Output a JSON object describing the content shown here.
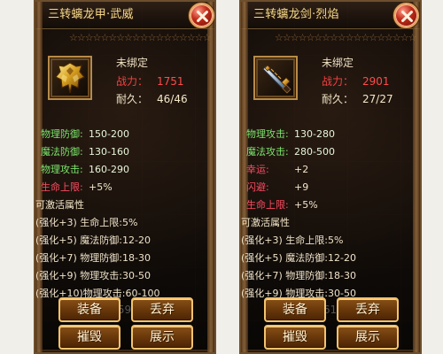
{
  "panels": [
    {
      "title": "三转螭龙甲·武威",
      "status": "未绑定",
      "power_label": "战力：",
      "power_value": "1751",
      "durability_label": "耐久：",
      "durability_value": "46/46",
      "bg_number": "116594",
      "stats": [
        {
          "label": "物理防御:",
          "value": "150-200"
        },
        {
          "label": "魔法防御:",
          "value": "130-160"
        },
        {
          "label": "物理攻击:",
          "value": "160-290"
        },
        {
          "label": "生命上限:",
          "value": "+5%"
        }
      ],
      "section_title": "可激活属性",
      "bonuses": [
        "(强化+3) 生命上限:5%",
        "(强化+5) 魔法防御:12-20",
        "(强化+7) 物理防御:18-30",
        "(强化+9) 物理攻击:30-50",
        "(强化+10)物理攻击:60-100"
      ],
      "buttons": {
        "equip": "装备",
        "drop": "丢弃",
        "destroy": "摧毁",
        "show": "展示"
      }
    },
    {
      "title": "三转螭龙剑·烈焰",
      "status": "未绑定",
      "power_label": "战力：",
      "power_value": "2901",
      "durability_label": "耐久：",
      "durability_value": "27/27",
      "bg_number": "358613/0",
      "stats": [
        {
          "label": "物理攻击:",
          "value": "130-280"
        },
        {
          "label": "魔法攻击:",
          "value": "280-500"
        },
        {
          "label": "幸运:",
          "value": "+2"
        },
        {
          "label": "闪避:",
          "value": "+9"
        },
        {
          "label": "生命上限:",
          "value": "+5%"
        }
      ],
      "section_title": "可激活属性",
      "bonuses": [
        "(强化+3) 生命上限:5%",
        "(强化+5) 魔法防御:12-20",
        "(强化+7) 物理防御:18-30",
        "(强化+9) 物理攻击:30-50"
      ],
      "buttons": {
        "equip": "装备",
        "drop": "丢弃",
        "destroy": "摧毁",
        "show": "展示"
      }
    }
  ]
}
